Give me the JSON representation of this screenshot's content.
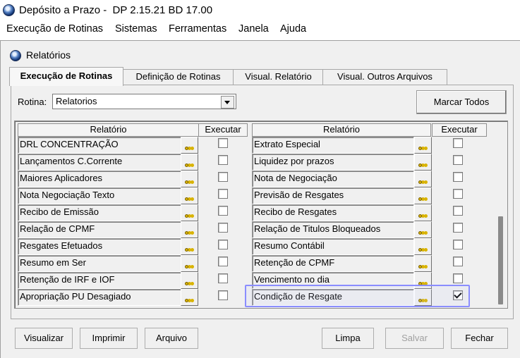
{
  "window": {
    "title": "Depósito a Prazo -  DP 2.15.21 BD 17.00"
  },
  "menu": [
    "Execução de Rotinas",
    "Sistemas",
    "Ferramentas",
    "Janela",
    "Ajuda"
  ],
  "child_window": {
    "title": "Relatórios"
  },
  "tabs": [
    "Execução de Rotinas",
    "Definição de Rotinas",
    "Visual. Relatório",
    "Visual. Outros Arquivos"
  ],
  "rotina": {
    "label": "Rotina:",
    "value": "Relatorios"
  },
  "buttons": {
    "marcar_todos": "Marcar Todos",
    "visualizar": "Visualizar",
    "imprimir": "Imprimir",
    "arquivo": "Arquivo",
    "limpa": "Limpa",
    "salvar": "Salvar",
    "fechar": "Fechar"
  },
  "grid": {
    "headers": {
      "relatorio": "Relatório",
      "executar": "Executar"
    },
    "left": [
      {
        "name": "DRL CONCENTRAÇÃO",
        "checked": false
      },
      {
        "name": "Lançamentos C.Corrente",
        "checked": false
      },
      {
        "name": "Maiores Aplicadores",
        "checked": false
      },
      {
        "name": "Nota Negociação Texto",
        "checked": false
      },
      {
        "name": "Recibo de Emissão",
        "checked": false
      },
      {
        "name": "Relação de CPMF",
        "checked": false
      },
      {
        "name": "Resgates Efetuados",
        "checked": false
      },
      {
        "name": "Resumo em Ser",
        "checked": false
      },
      {
        "name": "Retenção de IRF e IOF",
        "checked": false
      },
      {
        "name": "Apropriação PU Desagiado",
        "checked": false
      }
    ],
    "right": [
      {
        "name": "Extrato Especial",
        "checked": false
      },
      {
        "name": "Liquidez por prazos",
        "checked": false
      },
      {
        "name": "Nota de Negociação",
        "checked": false
      },
      {
        "name": "Previsão de Resgates",
        "checked": false
      },
      {
        "name": "Recibo de Resgates",
        "checked": false
      },
      {
        "name": "Relação de Titulos Bloqueados",
        "checked": false
      },
      {
        "name": "Resumo Contábil",
        "checked": false
      },
      {
        "name": "Retenção de CPMF",
        "checked": false
      },
      {
        "name": "Vencimento no dia",
        "checked": false
      },
      {
        "name": "Condição de Resgate",
        "checked": true
      }
    ]
  },
  "icons": {
    "app": "globe-app-icon",
    "lookup": "ellipsis-lookup-icon",
    "dropdown": "chevron-down-icon"
  },
  "colors": {
    "selection_highlight": "#8a8dff",
    "dots": "#d9b300"
  }
}
